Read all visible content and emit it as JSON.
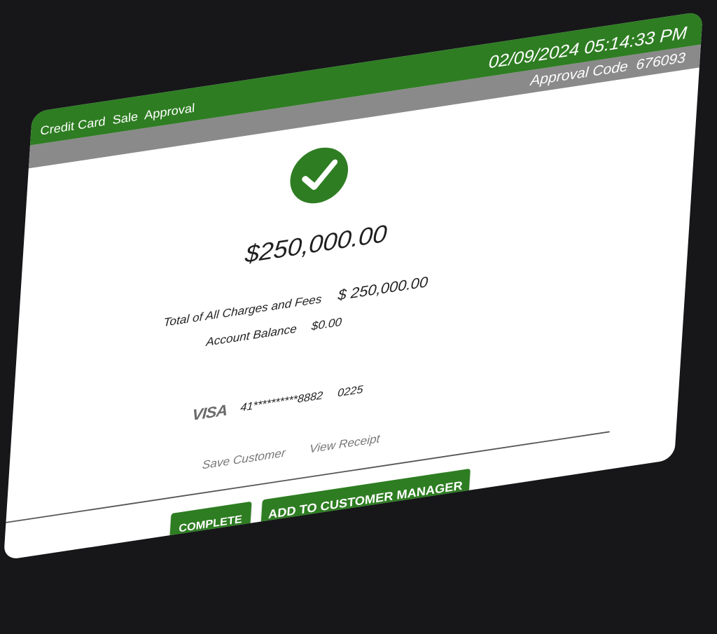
{
  "header": {
    "title": "Credit Card  Sale  Approval",
    "datetime": "02/09/2024 05:14:33 PM"
  },
  "subheader": {
    "approval_label": "Approval Code",
    "approval_code": "676093"
  },
  "status_icon": "checkmark-icon",
  "amount": "$250,000.00",
  "summary": {
    "total_label": "Total of All Charges and Fees",
    "total_value": "$ 250,000.00",
    "balance_label": "Account Balance",
    "balance_value": "$0.00"
  },
  "card": {
    "brand": "VISA",
    "masked_number": "41**********8882",
    "expiry": "0225"
  },
  "links": {
    "save_customer": "Save Customer",
    "view_receipt": "View Receipt"
  },
  "buttons": {
    "complete": "COMPLETE",
    "add_to_customer_manager": "ADD TO CUSTOMER MANAGER"
  },
  "colors": {
    "accent": "#2e7d22",
    "subheader": "#8a8a8a",
    "background": "#17171a"
  }
}
